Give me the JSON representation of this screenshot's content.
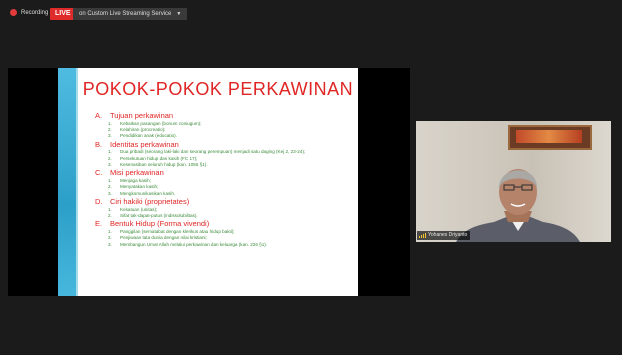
{
  "topbar": {
    "recording_label": "Recording",
    "live_label": "LIVE",
    "service_label": "on Custom Live Streaming Service",
    "service_dropdown_icon": "chevron-down-icon"
  },
  "slide": {
    "title": "POKOK-POKOK PERKAWINAN",
    "sections": [
      {
        "letter": "A.",
        "title": "Tujuan perkawinan",
        "items": [
          {
            "num": "1.",
            "text": "Kebaikan pasangan (bonum coniugum);"
          },
          {
            "num": "2.",
            "text": "Kelahiran (procreatio);"
          },
          {
            "num": "3.",
            "text": "Pendidikan anak (educatio)."
          }
        ]
      },
      {
        "letter": "B.",
        "title": "Identitas perkawinan",
        "items": [
          {
            "num": "1.",
            "text": "Dua pribadi (seorang laki-laki dan seorang perempuan) menjadi satu daging (Kej 2, 23-24);"
          },
          {
            "num": "2.",
            "text": "Persekutuan hidup dan kasih (FC 17);"
          },
          {
            "num": "3.",
            "text": "Kesenasiban seluruh hidup (kan. 1055 §1)."
          }
        ]
      },
      {
        "letter": "C.",
        "title": "Misi perkawinan",
        "items": [
          {
            "num": "1.",
            "text": "Menjaga kasih;"
          },
          {
            "num": "2.",
            "text": "Menyatakan kasih;"
          },
          {
            "num": "3.",
            "text": "Mengkomunikasikan kasih."
          }
        ]
      },
      {
        "letter": "D.",
        "title": "Ciri hakiki (proprietates)",
        "items": [
          {
            "num": "1.",
            "text": "Kesatuan (unitas);"
          },
          {
            "num": "2.",
            "text": "Sifat tak-dapat-putus (indissolubilitas)."
          }
        ]
      },
      {
        "letter": "E.",
        "title": "Bentuk Hidup (Forma vivendi)",
        "items": [
          {
            "num": "1.",
            "text": "Panggilan (sematabat dengan klerikus atau hidup bakti);"
          },
          {
            "num": "2.",
            "text": "Penjiwaan tata dunia dengan nilai kristiani;"
          },
          {
            "num": "3.",
            "text": "Membangun Umat Allah melalui perkawinan dan keluarga (kan. 226 §1)."
          }
        ]
      }
    ]
  },
  "participant": {
    "name": "Yohanes Driyanto",
    "signal_icon": "signal-bars-icon"
  },
  "colors": {
    "live_red": "#e02b2b",
    "slide_title_red": "#e02525",
    "slide_item_green": "#3a8b3a",
    "slide_band_blue": "#2c9fc8"
  }
}
